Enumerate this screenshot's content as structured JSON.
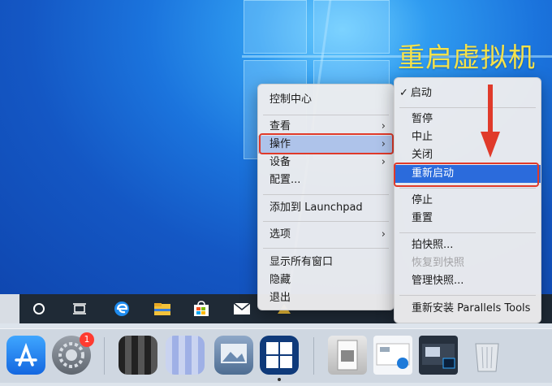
{
  "annotation": "重启虚拟机",
  "main_menu": {
    "items": {
      "control_center": "控制中心",
      "view": "查看",
      "actions": "操作",
      "devices": "设备",
      "configure": "配置...",
      "add_launchpad": "添加到 Launchpad",
      "options": "选项",
      "show_all": "显示所有窗口",
      "hide": "隐藏",
      "quit": "退出"
    }
  },
  "actions_submenu": {
    "check": "✓",
    "items": {
      "start": "启动",
      "pause": "暂停",
      "stop_mid": "中止",
      "shutdown": "关闭",
      "restart": "重新启动",
      "suspend": "停止",
      "reset": "重置",
      "snapshot": "拍快照...",
      "revert": "恢复到快照",
      "manage": "管理快照...",
      "reinstall": "重新安装 Parallels Tools"
    }
  },
  "dock": {
    "settings_badge": "1"
  },
  "colors": {
    "highlight": "#2b6bdc",
    "callout_red": "#e03a2a",
    "annotation_yellow": "#f6e24a"
  }
}
